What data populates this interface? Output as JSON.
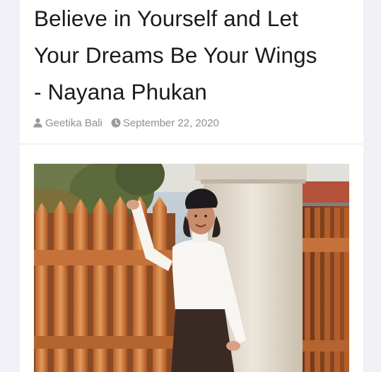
{
  "article": {
    "title_lines": [
      "Believe in Yourself and Let",
      "Your Dreams Be Your Wings",
      "- Nayana Phukan"
    ],
    "author": "Geetika Bali",
    "date": "September 22, 2020",
    "author_icon": "user-icon",
    "date_icon": "clock-icon",
    "image_description_icon": "article-photo"
  },
  "colors": {
    "page_background": "#f0f0f6",
    "card_background": "#ffffff",
    "title_text": "#1b1b1b",
    "meta_text": "#8f8f8f"
  }
}
